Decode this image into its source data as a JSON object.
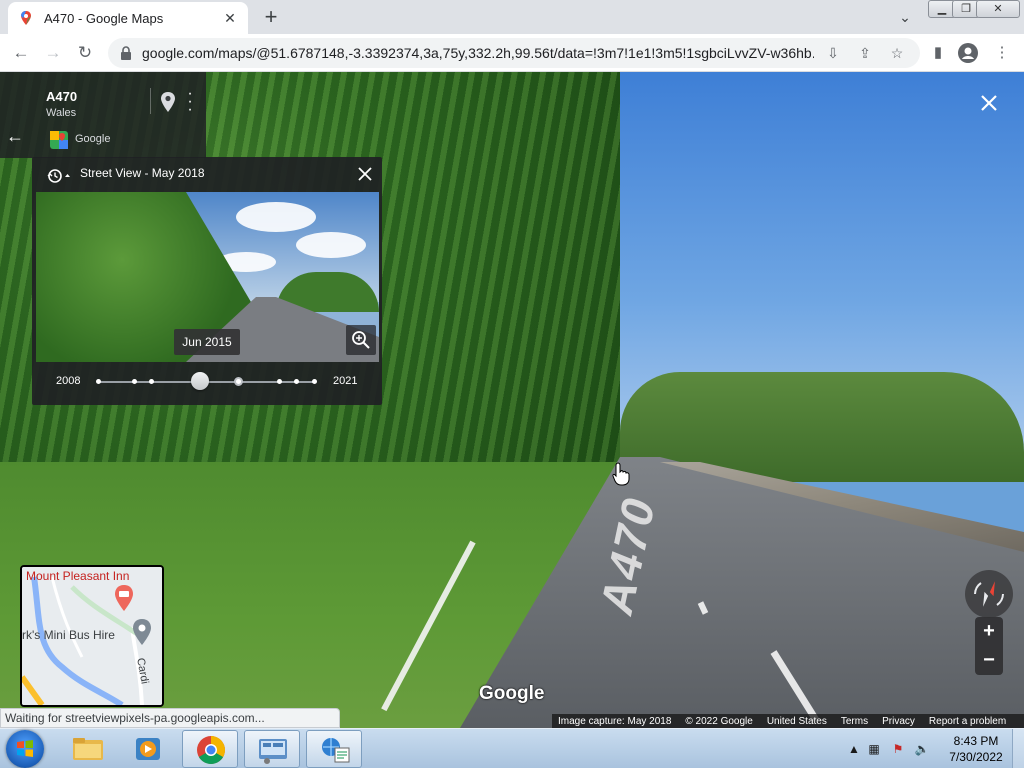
{
  "browser": {
    "tab_title": "A470 - Google Maps",
    "url": "google.com/maps/@51.6787148,-3.3392374,3a,75y,332.2h,99.56t/data=!3m7!1e1!3m5!1sgbciLvvZV-w36hb...",
    "status_text": "Waiting for streetviewpixels-pa.googleapis.com..."
  },
  "place_card": {
    "name": "A470",
    "region": "Wales",
    "provider": "Google"
  },
  "time_machine": {
    "header": "Street View - May 2018",
    "tooltip": "Jun 2015",
    "year_start": "2008",
    "year_end": "2021"
  },
  "road_marking": "A470",
  "minimap": {
    "poi1": "Mount Pleasant Inn",
    "poi2": "rk's Mini Bus Hire",
    "street": "Cardi"
  },
  "logo_text": "Google",
  "footer": {
    "image_capture": "Image capture: May 2018",
    "copyright": "© 2022 Google",
    "country": "United States",
    "terms": "Terms",
    "privacy": "Privacy",
    "report": "Report a problem"
  },
  "taskbar": {
    "time": "8:43 PM",
    "date": "7/30/2022"
  },
  "colors": {
    "accent_blue": "#1a73e8",
    "poi_red": "#c5221f"
  }
}
